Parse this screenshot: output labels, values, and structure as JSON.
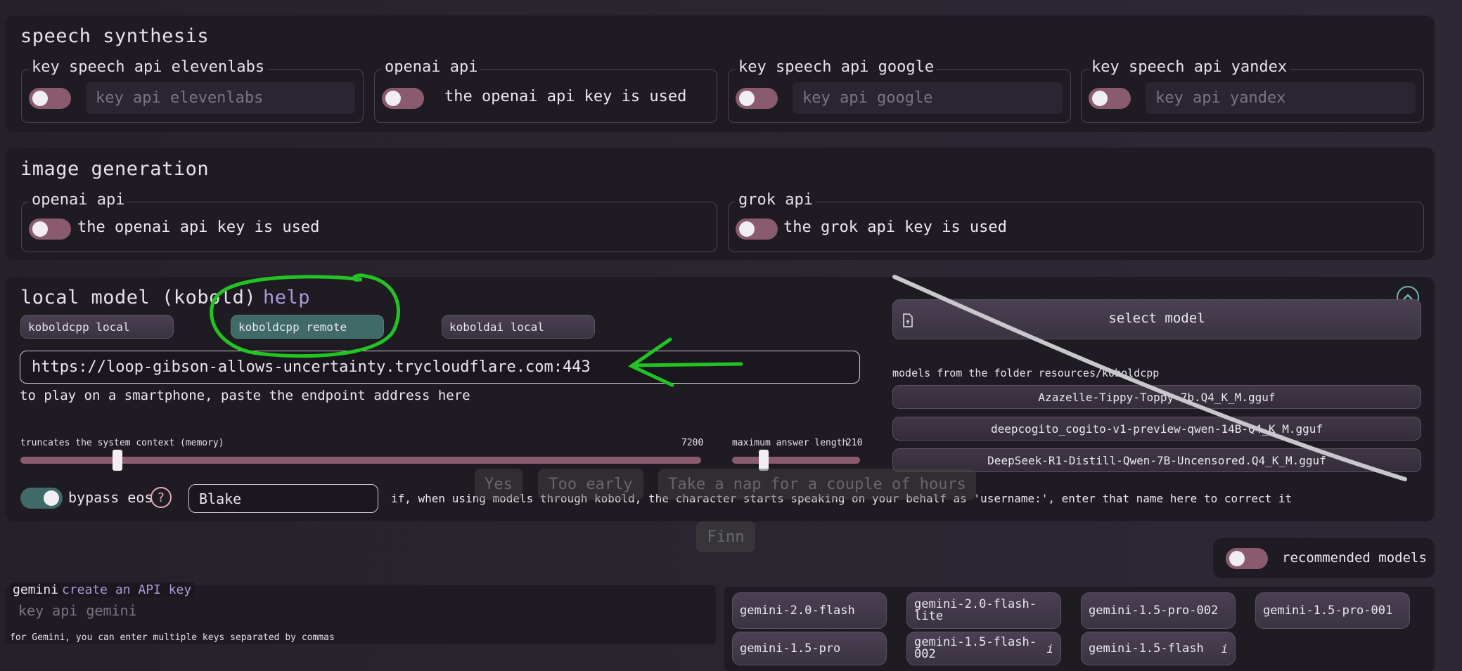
{
  "speech": {
    "title": "speech synthesis",
    "elevenlabs": {
      "legend": "key speech api elevenlabs",
      "placeholder": "key api elevenlabs"
    },
    "openai": {
      "legend": "openai api",
      "text": "the openai api key is used"
    },
    "google": {
      "legend": "key speech api google",
      "placeholder": "key api google"
    },
    "yandex": {
      "legend": "key speech api yandex",
      "placeholder": "key api yandex"
    }
  },
  "image": {
    "title": "image generation",
    "openai": {
      "legend": "openai api",
      "text": "the openai api key is used"
    },
    "grok": {
      "legend": "grok api",
      "text": "the grok api key is used"
    }
  },
  "local": {
    "title": "local model (kobold)",
    "help": "help",
    "modes": [
      "koboldcpp local",
      "koboldcpp remote",
      "koboldai local"
    ],
    "endpoint": "https://loop-gibson-allows-uncertainty.trycloudflare.com:443",
    "endpoint_hint": "to play on a smartphone, paste the endpoint address here",
    "memory_label": "truncates the system context (memory)",
    "memory_value": "7200",
    "answer_label": "maximum answer length",
    "answer_value": "210",
    "bypass_label": "bypass eos",
    "help_icon": "?",
    "username": "Blake",
    "username_hint": "if, when using models through kobold, the character starts speaking on your behalf as 'username:', enter that name here to correct it",
    "select_model": "select model",
    "folder_label": "models from the folder resources/koboldcpp",
    "models": [
      "Azazelle-Tippy-Toppy-7b.Q4_K_M.gguf",
      "deepcogito_cogito-v1-preview-qwen-14B-Q4_K_M.gguf",
      "DeepSeek-R1-Distill-Qwen-7B-Uncensored.Q4_K_M.gguf"
    ]
  },
  "ghost": {
    "yes": "Yes",
    "too_early": "Too early",
    "nap": "Take a nap for a couple of hours",
    "finn": "Finn"
  },
  "recommended": {
    "label": "recommended models"
  },
  "gemini": {
    "label": "gemini",
    "link": "create an API key",
    "placeholder": "key api gemini",
    "hint": "for Gemini, you can enter multiple keys separated by commas",
    "models": [
      "gemini-2.0-flash",
      "gemini-2.0-flash-lite",
      "gemini-1.5-pro-002",
      "gemini-1.5-pro-001",
      "gemini-1.5-pro",
      "gemini-1.5-flash-002",
      "gemini-1.5-flash"
    ],
    "info_icon": "i"
  },
  "colors": {
    "toggle_off": "#8a5a6e",
    "toggle_on": "#3f6a67",
    "help_link": "#a99bd6",
    "annotation": "#22c322"
  }
}
